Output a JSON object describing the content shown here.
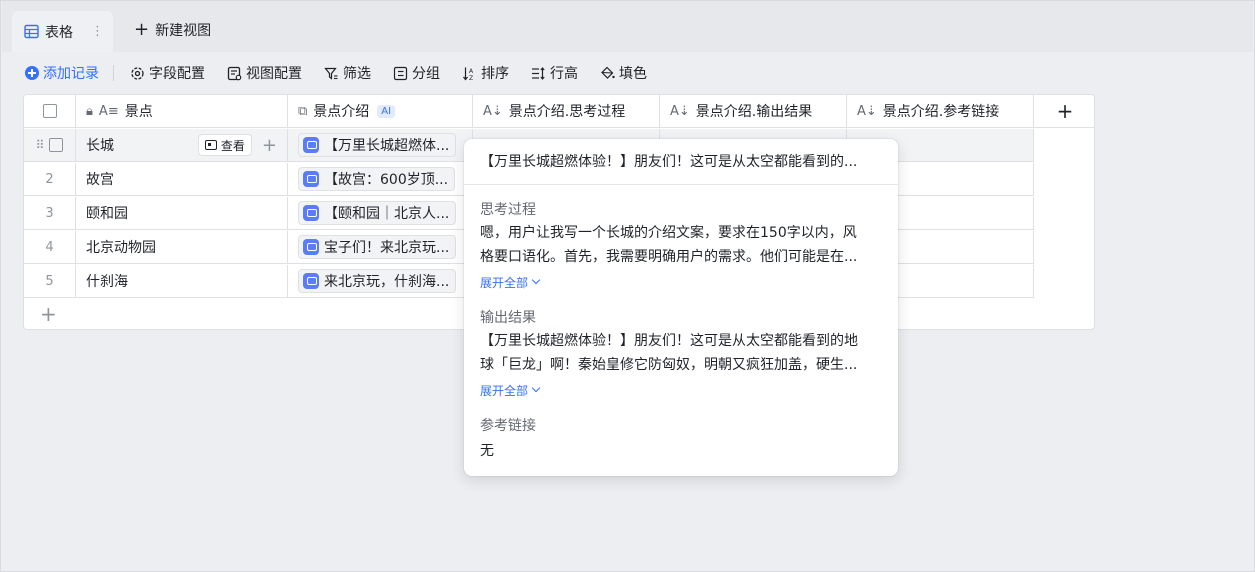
{
  "tabs": {
    "active_label": "表格",
    "new_view_label": "新建视图"
  },
  "toolbar": {
    "add_record": "添加记录",
    "field_config": "字段配置",
    "view_config": "视图配置",
    "filter": "筛选",
    "group": "分组",
    "sort": "排序",
    "row_height": "行高",
    "fill": "填色"
  },
  "table": {
    "headers": [
      "景点",
      "景点介绍",
      "景点介绍.思考过程",
      "景点介绍.输出结果",
      "景点介绍.参考链接"
    ],
    "ai_badge": "AI",
    "view_button": "查看",
    "rows": [
      {
        "index": "",
        "name": "长城",
        "intro": "【万里长城超燃体..."
      },
      {
        "index": "2",
        "name": "故宫",
        "intro": "【故宫：600岁顶..."
      },
      {
        "index": "3",
        "name": "颐和园",
        "intro": "【颐和园｜北京人..."
      },
      {
        "index": "4",
        "name": "北京动物园",
        "intro": "宝子们！来北京玩..."
      },
      {
        "index": "5",
        "name": "什刹海",
        "intro": "来北京玩，什刹海..."
      }
    ]
  },
  "popover": {
    "head": "【万里长城超燃体验！】朋友们！这可是从太空都能看到的...",
    "thinking_title": "思考过程",
    "thinking_line1": "嗯，用户让我写一个长城的介绍文案，要求在150字以内，风",
    "thinking_line2": "格要口语化。首先，我需要明确用户的需求。他们可能是在...",
    "expand_label": "展开全部",
    "output_title": "输出结果",
    "output_line1": "【万里长城超燃体验！】朋友们！这可是从太空都能看到的地",
    "output_line2": "球「巨龙」啊！秦始皇修它防匈奴，明朝又疯狂加盖，硬生...",
    "ref_title": "参考链接",
    "ref_value": "无"
  }
}
